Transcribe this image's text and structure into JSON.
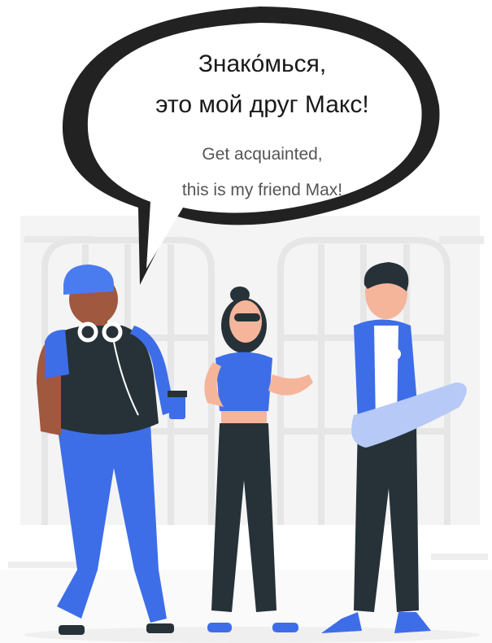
{
  "speech": {
    "russian_line1": "Знако́мься,",
    "russian_line2": "это мой друг Макс!",
    "english_line1": "Get acquainted,",
    "english_line2": "this is my friend Max!"
  },
  "colors": {
    "accent_blue": "#3d6ee8",
    "dark": "#263238",
    "skin_dark": "#a0583f",
    "skin_light": "#f5b59a",
    "skateboard": "#b7c9f7",
    "background": "#f2f2f2"
  }
}
